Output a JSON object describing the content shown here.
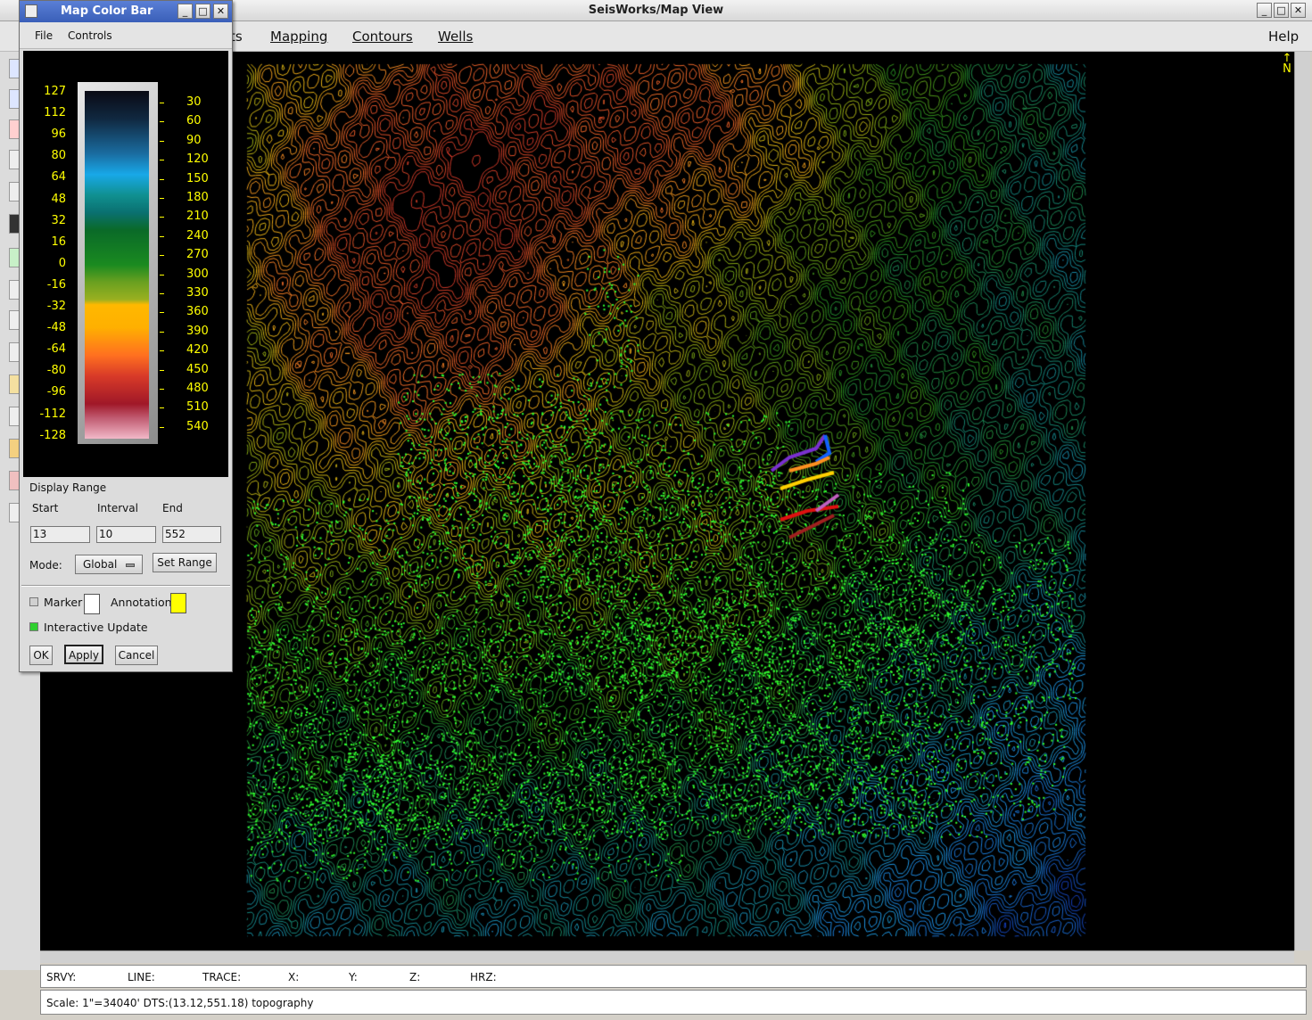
{
  "main_window": {
    "title": "SeisWorks/Map View",
    "menu": [
      "ts",
      "Mapping",
      "Contours",
      "Wells",
      "Help"
    ]
  },
  "status": {
    "srvy": "SRVY:",
    "line": "LINE:",
    "trace": "TRACE:",
    "x": "X:",
    "y": "Y:",
    "z": "Z:",
    "hrz": "HRZ:",
    "scale": "Scale: 1\"=34040' DTS:(13.12,551.18) topography"
  },
  "color_bar_window": {
    "title": "Map Color Bar",
    "menu": {
      "file": "File",
      "controls": "Controls"
    },
    "left_labels": [
      "127",
      "112",
      "96",
      "80",
      "64",
      "48",
      "32",
      "16",
      "0",
      "-16",
      "-32",
      "-48",
      "-64",
      "-80",
      "-96",
      "-112",
      "-128"
    ],
    "right_labels": [
      "30",
      "60",
      "90",
      "120",
      "150",
      "180",
      "210",
      "240",
      "270",
      "300",
      "330",
      "360",
      "390",
      "420",
      "450",
      "480",
      "510",
      "540"
    ],
    "display_range": {
      "heading": "Display Range",
      "start_label": "Start",
      "interval_label": "Interval",
      "end_label": "End",
      "start_value": "13",
      "interval_value": "10",
      "end_value": "552"
    },
    "mode_label": "Mode:",
    "mode_value": "Global",
    "set_range_label": "Set Range",
    "marker_label": "Marker",
    "annotation_label": "Annotation",
    "annotation_color": "#ffff00",
    "interactive_update_label": "Interactive Update",
    "interactive_update_checked": true,
    "ok_label": "OK",
    "apply_label": "Apply",
    "cancel_label": "Cancel"
  },
  "map": {
    "north_label": "N"
  }
}
